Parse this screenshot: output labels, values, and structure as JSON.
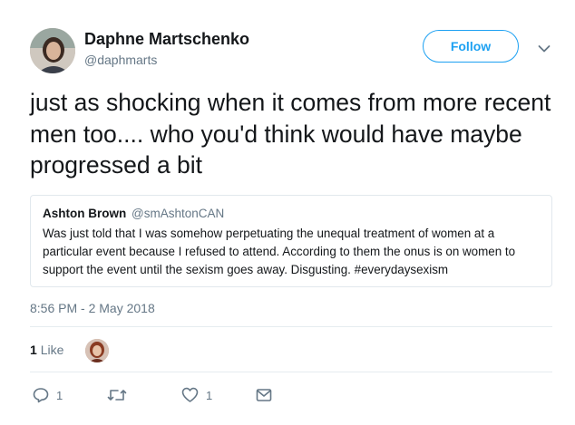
{
  "author": {
    "name": "Daphne Martschenko",
    "handle": "@daphmarts"
  },
  "follow_label": "Follow",
  "tweet": {
    "text": "just as shocking when it comes from more recent men too.... who you'd think would have maybe progressed a bit"
  },
  "quoted": {
    "name": "Ashton Brown",
    "handle": "@smAshtonCAN",
    "text": "Was just told that I was somehow perpetuating the unequal treatment of women at a particular event because I refused to attend. According to them the onus is on women to support the event until the sexism goes away. Disgusting. #everydaysexism"
  },
  "timestamp": "8:56 PM - 2 May 2018",
  "likes": {
    "count": "1",
    "label": "Like"
  },
  "actions": {
    "reply_count": "1",
    "like_count": "1"
  },
  "icons": {
    "reply": "reply-icon",
    "retweet": "retweet-icon",
    "like": "heart-icon",
    "dm": "envelope-icon",
    "caret": "chevron-down-icon"
  },
  "colors": {
    "accent": "#1da1f2",
    "secondary_text": "#657786",
    "border": "#e1e8ed"
  }
}
